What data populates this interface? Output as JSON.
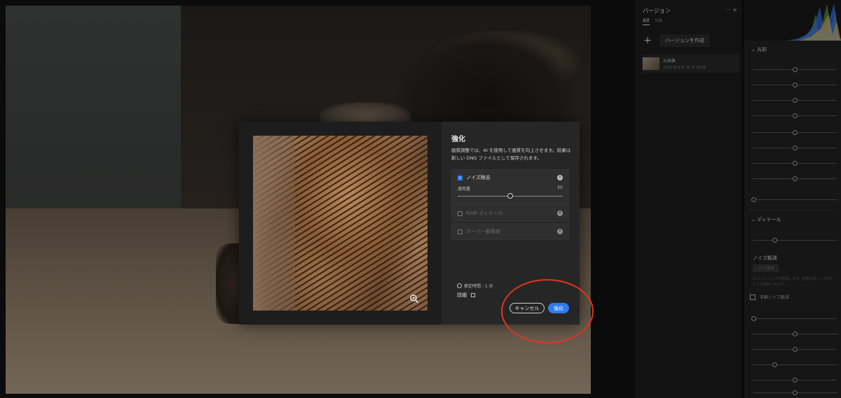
{
  "versions_panel": {
    "title": "バージョン",
    "tabs": [
      "履歴",
      "比較"
    ],
    "create_label": "バージョンを作成",
    "item": {
      "name": "元画像",
      "date": "2023 年 6 月 29 日  18:28"
    }
  },
  "edit_panel": {
    "section_light": "光彩",
    "section_detail": "ディテール",
    "noise_section": "ノイズ軽減",
    "noise_button": "ノイズ除去",
    "noise_desc": "AI によりノイズを軽減します。結果は新しい DNG として保存されます。",
    "manual_noise": "手動ノイズ軽減"
  },
  "dialog": {
    "title": "強化",
    "description": "画質調整では、AI を使用して画質を向上させます。結果は新しい DNG ファイルとして保存されます。",
    "options": {
      "denoise": {
        "label": "ノイズ除去",
        "checked": true,
        "amount_label": "適用量",
        "amount_value": "50",
        "amount_fraction": 0.5
      },
      "raw_details": {
        "label": "RAW ディテール",
        "enabled": false
      },
      "super_resolution": {
        "label": "スーパー解像度",
        "enabled": false
      }
    },
    "estimated_time": "推定時間 : 1 分",
    "details_link": "詳細",
    "cancel_label": "キャンセル",
    "enhance_label": "強化"
  },
  "colors": {
    "accent": "#2f7be9",
    "annotation": "#e2341f"
  },
  "icons": {
    "info": "info-icon",
    "zoom": "zoom-icon",
    "clock": "clock-icon",
    "external": "external-link-icon"
  }
}
